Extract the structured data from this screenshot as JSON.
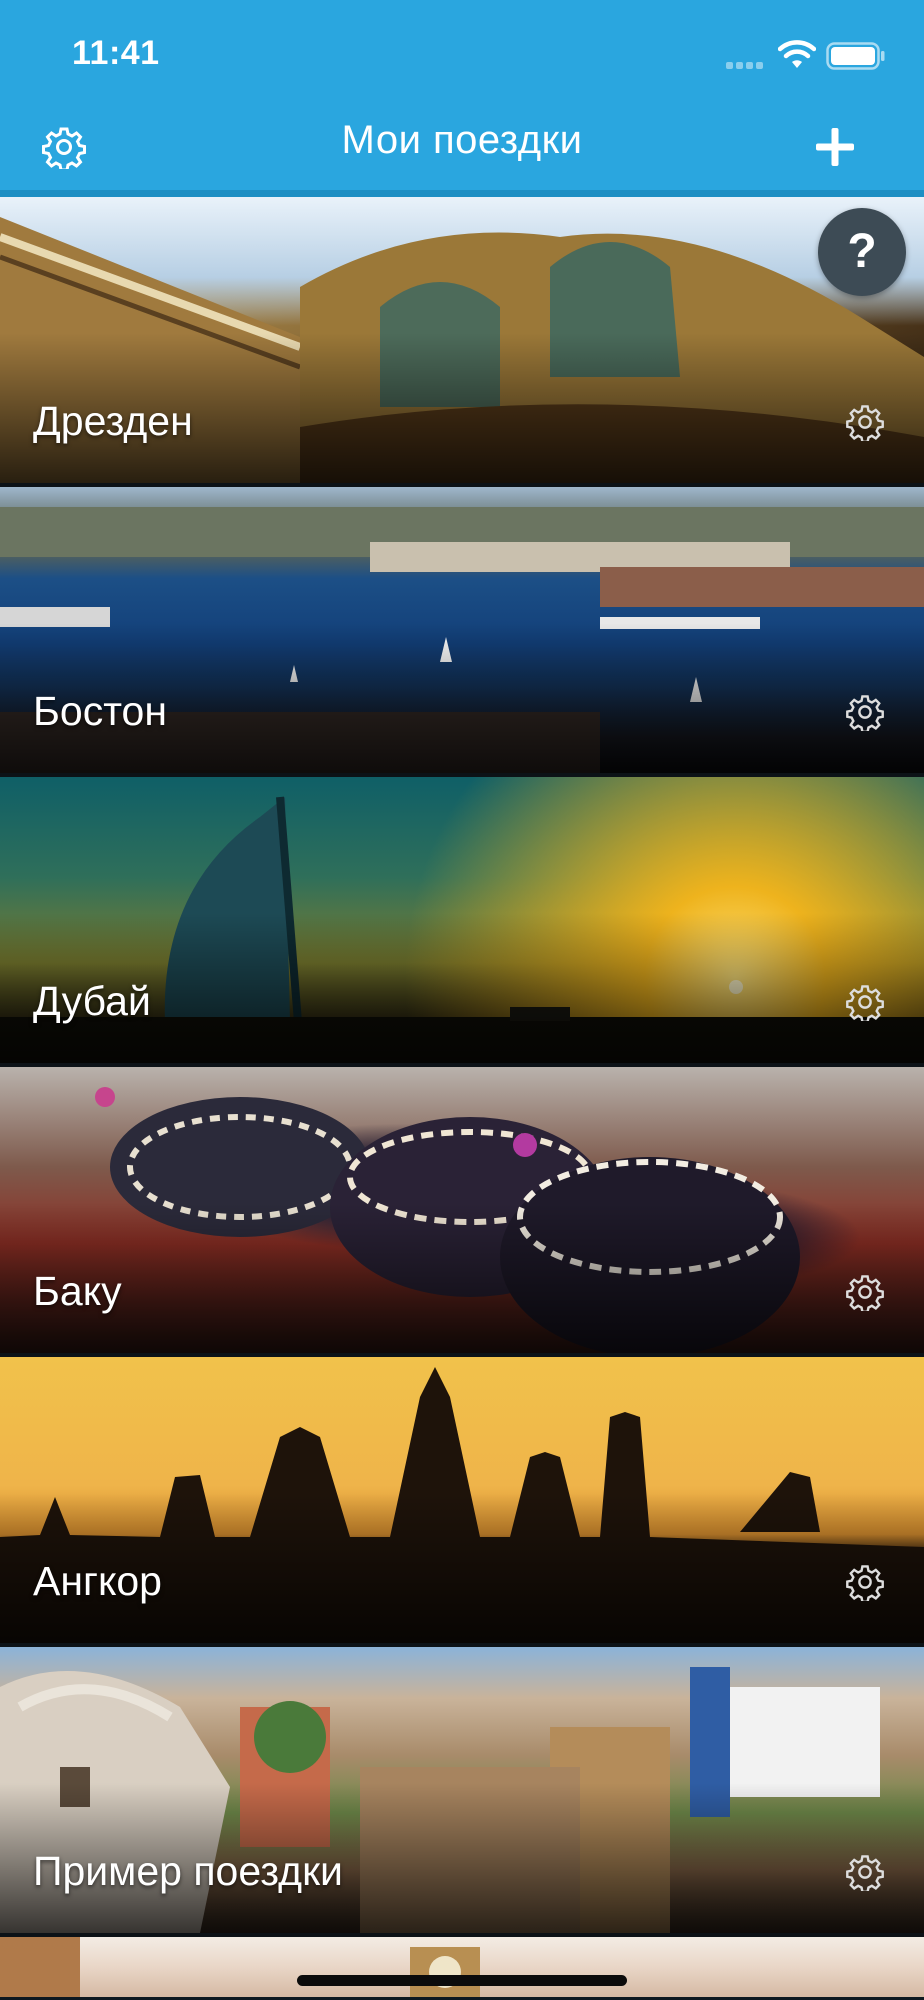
{
  "status_bar": {
    "time": "11:41"
  },
  "header": {
    "title": "Мои поездки"
  },
  "help_button": {
    "label": "?"
  },
  "trips": [
    {
      "name": "Дрезден"
    },
    {
      "name": "Бостон"
    },
    {
      "name": "Дубай"
    },
    {
      "name": "Баку"
    },
    {
      "name": "Ангкор"
    },
    {
      "name": "Пример поездки"
    }
  ],
  "colors": {
    "header": "#2aa6df",
    "help_button": "#3d4b55"
  },
  "icons": [
    "settings-icon",
    "plus-icon",
    "question-icon",
    "gear-icon",
    "wifi-icon",
    "battery-icon"
  ]
}
